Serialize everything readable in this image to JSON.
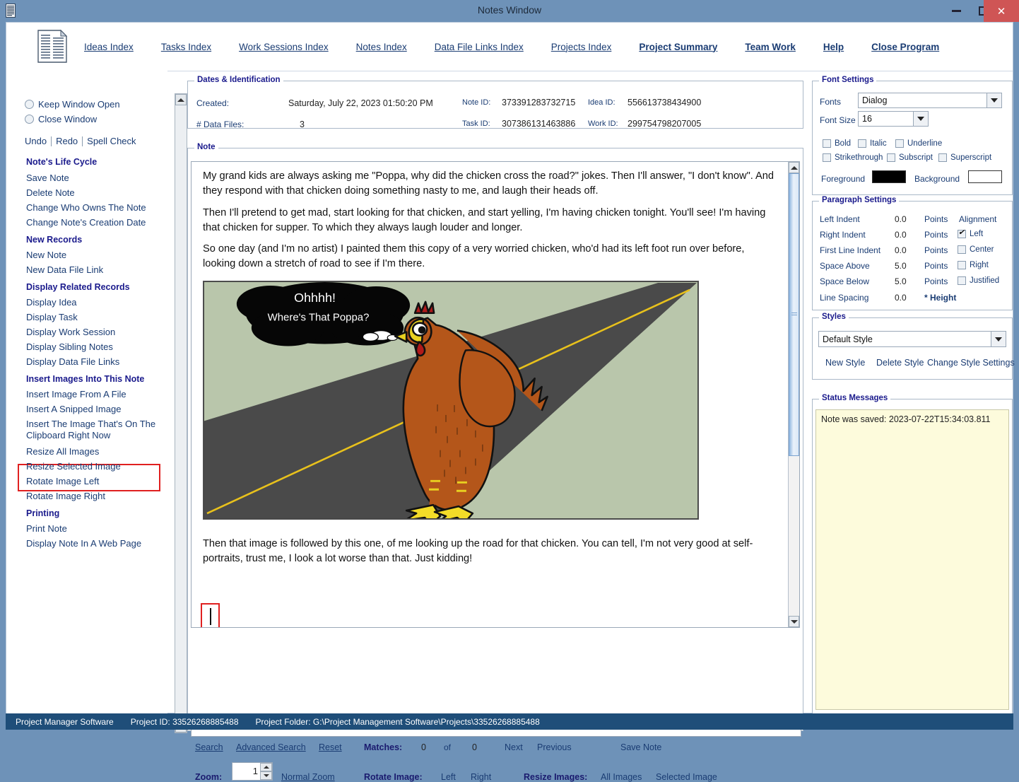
{
  "window": {
    "title": "Notes Window",
    "icon": "document-icon",
    "minimize_label": "–",
    "maximize_label": "□",
    "close_label": "✕"
  },
  "topnav": {
    "items": [
      {
        "label": "Ideas Index",
        "bold": false
      },
      {
        "label": "Tasks Index",
        "bold": false
      },
      {
        "label": "Work Sessions Index",
        "bold": false
      },
      {
        "label": "Notes Index",
        "bold": false
      },
      {
        "label": "Data File Links Index",
        "bold": false
      },
      {
        "label": "Projects Index",
        "bold": false
      },
      {
        "label": "Project Summary",
        "bold": true
      },
      {
        "label": "Team Work",
        "bold": true
      },
      {
        "label": "Help",
        "bold": true
      },
      {
        "label": "Close Program",
        "bold": true
      }
    ]
  },
  "sidebar": {
    "radios": [
      {
        "label": "Keep Window Open",
        "selected": false
      },
      {
        "label": "Close Window",
        "selected": false
      }
    ],
    "edit_actions": [
      "Undo",
      "Redo",
      "Spell Check"
    ],
    "groups": [
      {
        "heading": "Note's Life Cycle",
        "items": [
          "Save Note",
          "Delete Note",
          "Change Who Owns The Note",
          "Change Note's Creation Date"
        ]
      },
      {
        "heading": "New Records",
        "items": [
          "New Note",
          "New Data File Link"
        ]
      },
      {
        "heading": "Display Related Records",
        "items": [
          "Display Idea",
          "Display Task",
          "Display Work Session",
          "Display Sibling Notes",
          "Display Data File Links"
        ]
      },
      {
        "heading": "Insert Images Into This Note",
        "items": [
          "Insert Image From A File",
          "Insert A Snipped Image",
          "Insert The Image That's On The Clipboard Right Now",
          "Resize All Images",
          "Resize Selected Image",
          "Rotate Image Left",
          "Rotate Image Right"
        ]
      },
      {
        "heading": "Printing",
        "items": [
          "Print Note",
          "Display Note In A Web Page"
        ]
      }
    ],
    "highlighted_item": "Insert The Image That's On The Clipboard Right Now",
    "highlight_color": "#e02020"
  },
  "dates_section": {
    "legend": "Dates & Identification",
    "created_label": "Created:",
    "created_value": "Saturday, July 22, 2023  01:50:20 PM",
    "data_files_label": "# Data Files:",
    "data_files_value": "3",
    "note_id_label": "Note ID:",
    "note_id_value": "373391283732715",
    "idea_id_label": "Idea ID:",
    "idea_id_value": "556613738434900",
    "task_id_label": "Task ID:",
    "task_id_value": "307386131463886",
    "work_id_label": "Work ID:",
    "work_id_value": "299754798207005"
  },
  "note_section": {
    "legend": "Note",
    "paragraphs": [
      "My grand kids are always asking me \"Poppa, why did the chicken cross the road?\" jokes. Then I'll answer, \"I don't know\". And they respond with that chicken doing something nasty to me, and laugh their heads off.",
      "Then I'll pretend to get mad, start looking for that chicken, and start yelling, I'm having chicken tonight. You'll see! I'm having that chicken for supper. To which they always laugh louder and longer.",
      "So one day (and I'm no artist) I painted them this copy of a very worried chicken, who'd had its left foot run over before, looking down a stretch of road to see if I'm there."
    ],
    "image": {
      "name": "worried-chicken-on-road-illustration",
      "thought_line1": "Ohhhh!",
      "thought_line2": "Where's That Poppa?",
      "background_color": "#b9c6ab",
      "road_color": "#4a4a4a",
      "centerline_color": "#e8c11c",
      "chicken_color": "#b4561a"
    },
    "closing_paragraph": "Then that image is followed by this one, of me looking up the road for that chicken. You can tell, I'm not very good at self-portraits, trust me, I look a lot worse than that. Just kidding!"
  },
  "searchbar": {
    "search_value": "",
    "search_label": "Search",
    "advanced_search_label": "Advanced Search",
    "reset_label": "Reset",
    "matches_label": "Matches:",
    "matches_current": "0",
    "of_label": "of",
    "matches_total": "0",
    "next_label": "Next",
    "previous_label": "Previous",
    "save_note_label": "Save Note"
  },
  "imagebar": {
    "zoom_label": "Zoom:",
    "zoom_value": "1",
    "normal_zoom_label": "Normal Zoom",
    "rotate_image_label": "Rotate Image:",
    "rotate_left_label": "Left",
    "rotate_right_label": "Right",
    "resize_images_label": "Resize Images:",
    "all_images_label": "All Images",
    "selected_image_label": "Selected Image"
  },
  "font_settings": {
    "legend": "Font Settings",
    "fonts_label": "Fonts",
    "fonts_value": "Dialog",
    "font_size_label": "Font Size",
    "font_size_value": "16",
    "checkboxes": [
      {
        "label": "Bold",
        "checked": false
      },
      {
        "label": "Italic",
        "checked": false
      },
      {
        "label": "Underline",
        "checked": false
      },
      {
        "label": "Strikethrough",
        "checked": false
      },
      {
        "label": "Subscript",
        "checked": false
      },
      {
        "label": "Superscript",
        "checked": false
      }
    ],
    "foreground_label": "Foreground",
    "foreground_color": "#000000",
    "background_label": "Background",
    "background_color": "#ffffff"
  },
  "paragraph_settings": {
    "legend": "Paragraph Settings",
    "rows": [
      {
        "label": "Left Indent",
        "value": "0.0",
        "unit": "Points"
      },
      {
        "label": "Right Indent",
        "value": "0.0",
        "unit": "Points"
      },
      {
        "label": "First Line Indent",
        "value": "0.0",
        "unit": "Points"
      },
      {
        "label": "Space Above",
        "value": "5.0",
        "unit": "Points"
      },
      {
        "label": "Space Below",
        "value": "5.0",
        "unit": "Points"
      },
      {
        "label": "Line Spacing",
        "value": "0.0",
        "unit": "* Height"
      }
    ],
    "alignment_label": "Alignment",
    "alignments": [
      {
        "label": "Left",
        "checked": true
      },
      {
        "label": "Center",
        "checked": false
      },
      {
        "label": "Right",
        "checked": false
      },
      {
        "label": "Justified",
        "checked": false
      }
    ]
  },
  "styles": {
    "legend": "Styles",
    "selected_style": "Default Style",
    "new_style_label": "New Style",
    "delete_style_label": "Delete Style",
    "change_style_settings_label": "Change Style Settings"
  },
  "status_messages": {
    "legend": "Status Messages",
    "message": "Note was saved:  2023-07-22T15:34:03.811",
    "background_color": "#fdfbdc"
  },
  "statusbar": {
    "app_name": "Project Manager Software",
    "project_id_label": "Project ID:  33526268885488",
    "project_folder_label": "Project Folder: G:\\Project Management Software\\Projects\\33526268885488",
    "background_color": "#1f4e79"
  }
}
